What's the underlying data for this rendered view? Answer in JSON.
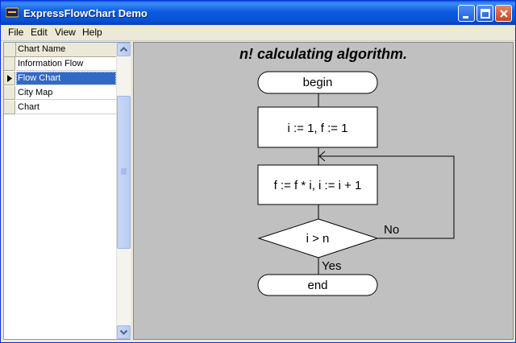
{
  "window": {
    "title": "ExpressFlowChart Demo"
  },
  "menu": [
    "File",
    "Edit",
    "View",
    "Help"
  ],
  "grid": {
    "header": "Chart Name",
    "rows": [
      "Information Flow",
      "Flow Chart",
      "City Map",
      "Chart"
    ],
    "selected_index": 1
  },
  "flowchart": {
    "title": "n! calculating algorithm.",
    "begin": "begin",
    "init": "i := 1, f := 1",
    "step": "f := f * i, i := i + 1",
    "condition": "i > n",
    "no_label": "No",
    "yes_label": "Yes",
    "end": "end"
  },
  "colors": {
    "titlebar": "#0653d6",
    "selection": "#316ac5",
    "canvas": "#c0c0c0"
  }
}
